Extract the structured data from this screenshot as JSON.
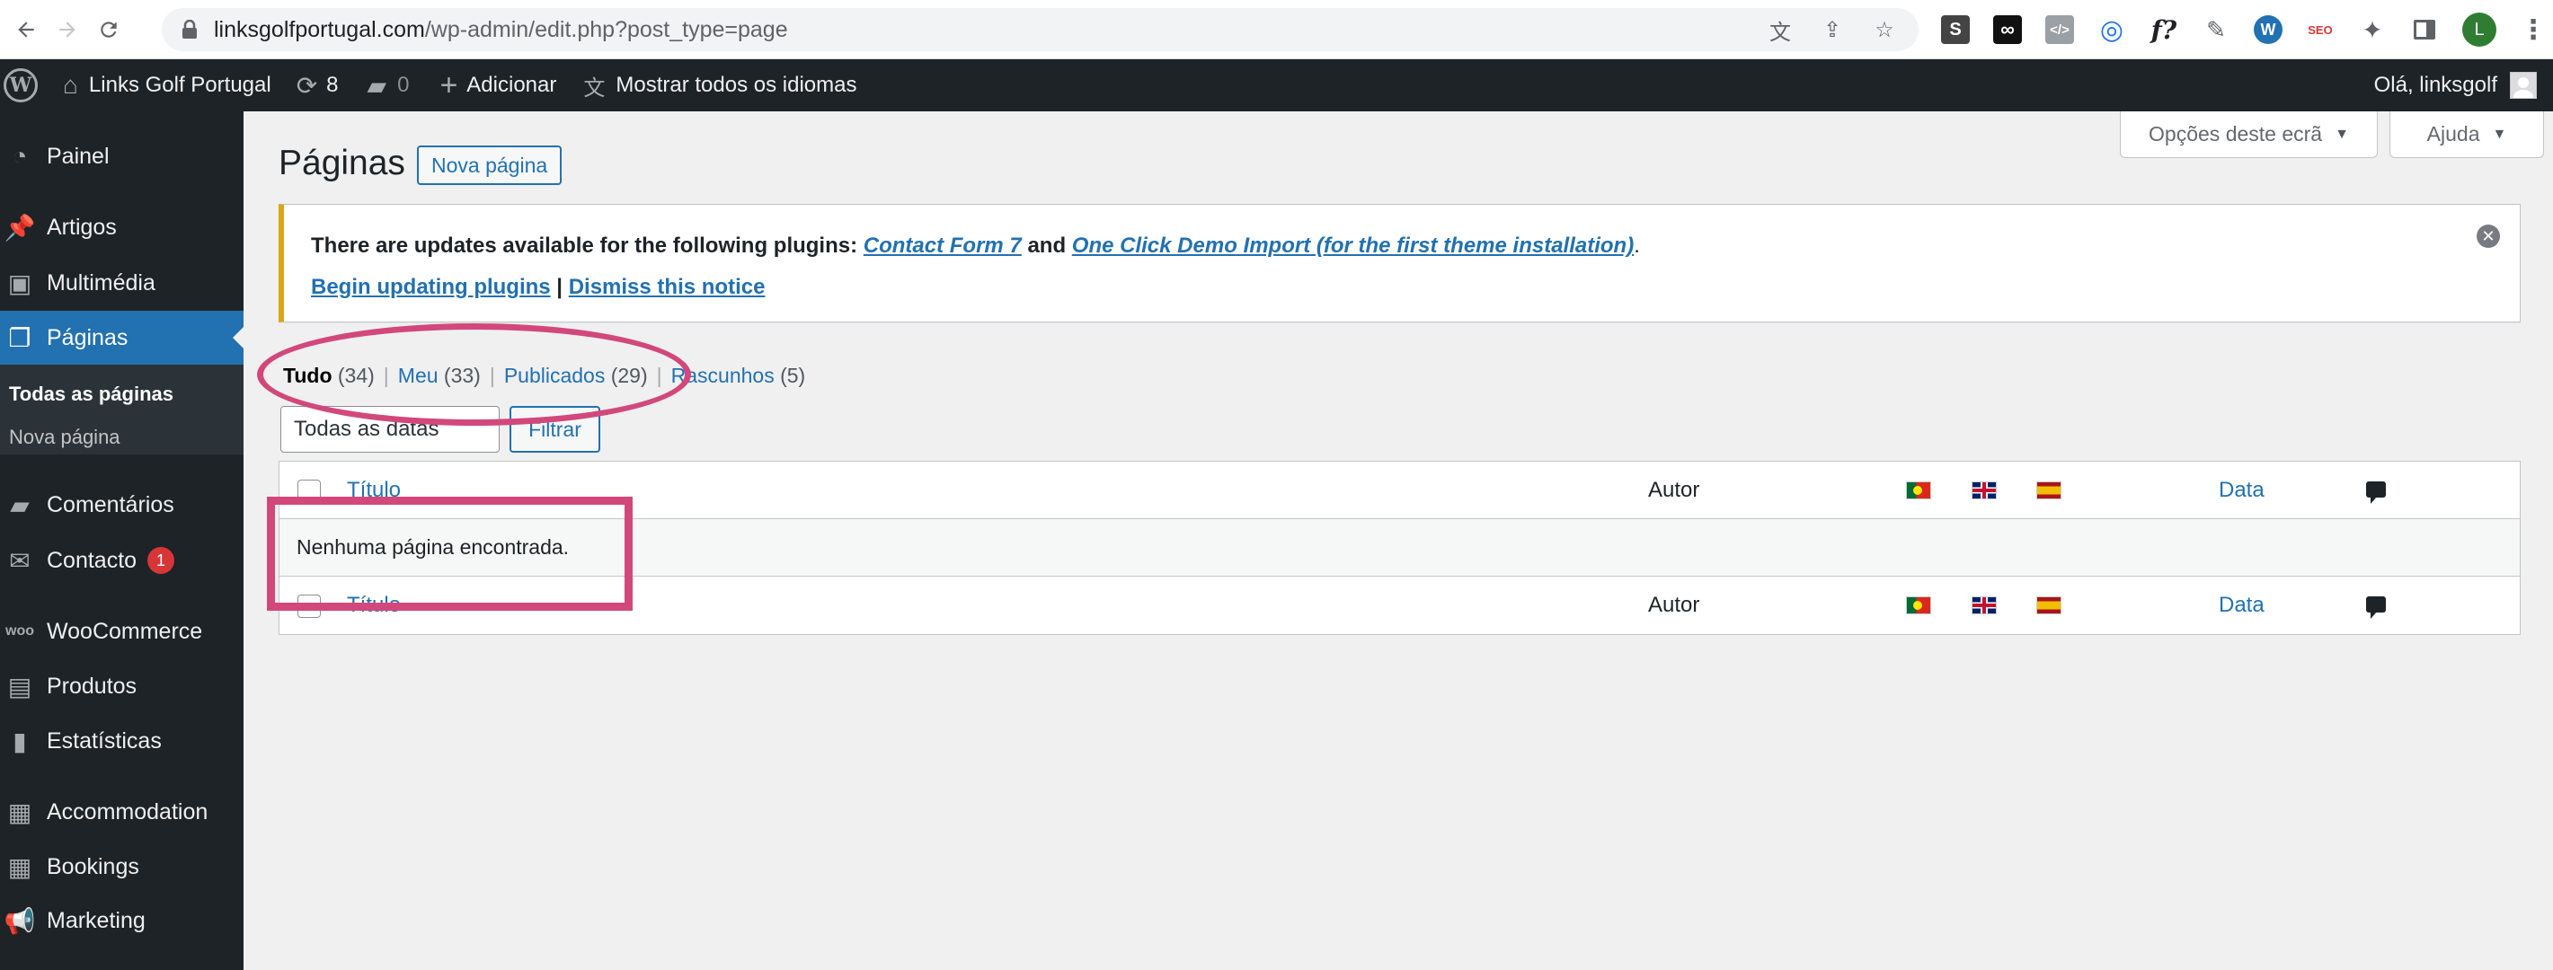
{
  "browser": {
    "url_host": "linksgolfportugal.com",
    "url_path": "/wp-admin/edit.php?post_type=page",
    "profile_initial": "L",
    "extensions": [
      "S",
      "∞",
      "</>",
      "f?",
      "SEO"
    ]
  },
  "adminbar": {
    "site_name": "Links Golf Portugal",
    "updates_count": "8",
    "comments_count": "0",
    "add_new": "Adicionar",
    "languages": "Mostrar todos os idiomas",
    "greeting": "Olá, linksgolf"
  },
  "sidebar": {
    "items": [
      {
        "label": "Painel"
      },
      {
        "label": "Artigos"
      },
      {
        "label": "Multimédia"
      },
      {
        "label": "Páginas"
      },
      {
        "label": "Comentários"
      },
      {
        "label": "Contacto"
      },
      {
        "label": "WooCommerce"
      },
      {
        "label": "Produtos"
      },
      {
        "label": "Estatísticas"
      },
      {
        "label": "Accommodation"
      },
      {
        "label": "Bookings"
      },
      {
        "label": "Marketing"
      }
    ],
    "submenu": [
      "Todas as páginas",
      "Nova página"
    ],
    "contact_badge": "1"
  },
  "screen": {
    "options_label": "Opções deste ecrã",
    "help_label": "Ajuda",
    "title": "Páginas",
    "add_new": "Nova página"
  },
  "notice": {
    "text_before": "There are updates available for the following plugins: ",
    "plugin1": "Contact Form 7",
    "and": " and ",
    "plugin2": "One Click Demo Import (for the first theme installation)",
    "period": ".",
    "begin": "Begin updating plugins",
    "separator": " | ",
    "dismiss": "Dismiss this notice"
  },
  "views": [
    {
      "label": "Tudo",
      "count": "(34)"
    },
    {
      "label": "Meu",
      "count": "(33)"
    },
    {
      "label": "Publicados",
      "count": "(29)"
    },
    {
      "label": "Rascunhos",
      "count": "(5)"
    }
  ],
  "filters": {
    "date_selected": "Todas as datas",
    "filter_button": "Filtrar"
  },
  "table": {
    "col_title": "Título",
    "col_author": "Autor",
    "col_date": "Data",
    "empty_message": "Nenhuma página encontrada."
  },
  "colors": {
    "accent": "#2271b1",
    "adminbar_bg": "#1d2327",
    "annotation": "#d2487b",
    "notice_warning": "#dba617"
  }
}
